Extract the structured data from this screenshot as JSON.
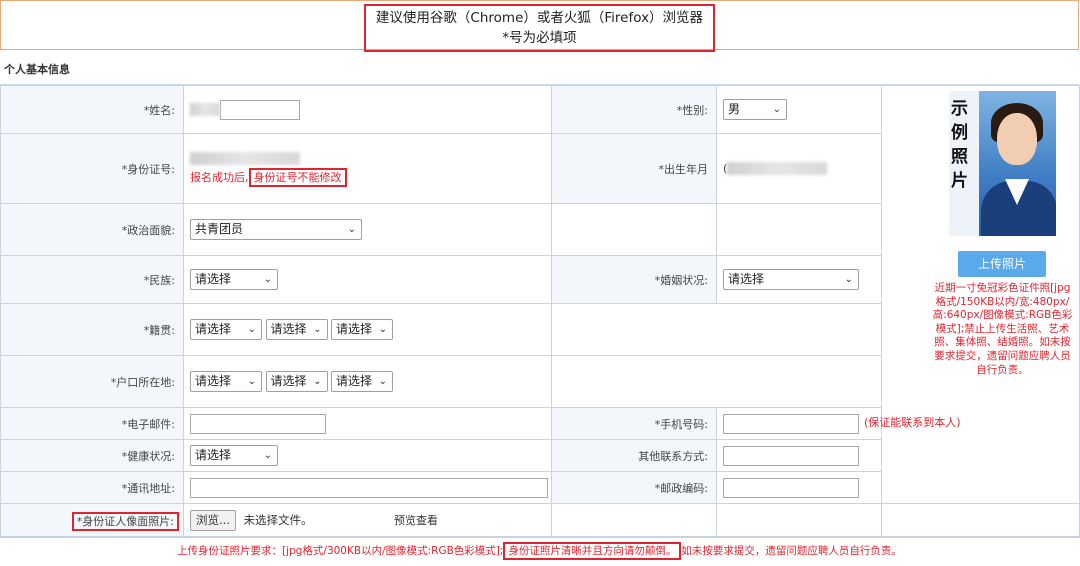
{
  "banner": {
    "line1": "建议使用谷歌（Chrome）或者火狐（Firefox）浏览器",
    "line2": "*号为必填项"
  },
  "section_title": "个人基本信息",
  "fields": {
    "name_label": "*姓名:",
    "gender_label": "*性别:",
    "gender_value": "男",
    "idno_label": "*身份证号:",
    "id_note_prefix": "报名成功后,",
    "id_note_box": "身份证号不能修改",
    "birth_label": "*出生年月",
    "birth_prefix": "(",
    "political_label": "*政治面貌:",
    "political_value": "共青团员",
    "ethnic_label": "*民族:",
    "ethnic_value": "请选择",
    "marital_label": "*婚姻状况:",
    "marital_value": "请选择",
    "native_label": "*籍贯:",
    "native_values": [
      "请选择",
      "请选择",
      "请选择"
    ],
    "hukou_label": "*户口所在地:",
    "hukou_values": [
      "请选择",
      "请选择",
      "请选择"
    ],
    "email_label": "*电子邮件:",
    "phone_label": "*手机号码:",
    "phone_note": "(保证能联系到本人)",
    "health_label": "*健康状况:",
    "health_value": "请选择",
    "other_contact_label": "其他联系方式:",
    "address_label": "*通讯地址:",
    "zip_label": "*邮政编码:",
    "idphoto_label": "*身份证人像面照片:",
    "browse_label": "浏览...",
    "no_file": "未选择文件。",
    "preview": "预览查看"
  },
  "photo": {
    "sample_chars": [
      "示",
      "例",
      "照",
      "片"
    ],
    "upload_button": "上传照片",
    "note": "近期一寸免冠彩色证件照[jpg格式/150KB以内/宽:480px/高:640px/图像模式:RGB色彩模式];禁止上传生活照、艺术照、集体照、结婚照。如未按要求提交，遗留问题应聘人员自行负责。"
  },
  "footer": {
    "prefix": "上传身份证照片要求：[jpg格式/300KB以内/图像模式:RGB色彩模式];",
    "boxed": "身份证照片清晰并且方向请勿颠倒。",
    "suffix": "如未按要求提交，遗留问题应聘人员自行负责。"
  },
  "colors": {
    "required_red": "#e0242f",
    "upload_blue": "#5aa9ea",
    "label_bg": "#f3f7fb",
    "border": "#c6d4e3"
  }
}
